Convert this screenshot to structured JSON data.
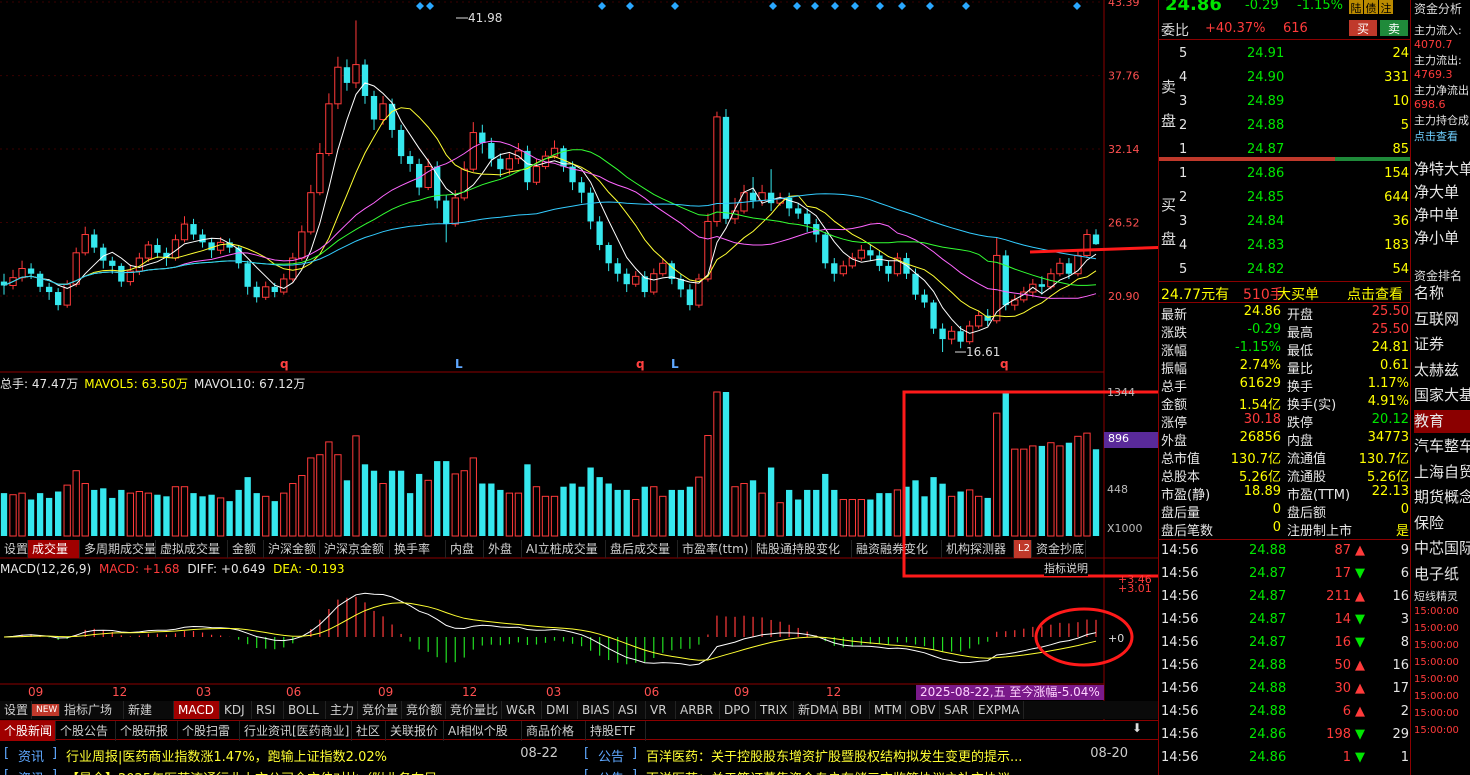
{
  "chart_data": {
    "type": "candlestick",
    "price_axis": {
      "ticks": [
        "43.39",
        "37.76",
        "32.14",
        "26.52",
        "20.90"
      ],
      "range": [
        17.0,
        43.39
      ]
    },
    "annotations": {
      "high": "41.98",
      "low": "16.61"
    },
    "markers": [
      "q",
      "L",
      "q",
      "L",
      "q"
    ],
    "ohlc": [
      [
        22.0,
        21.7,
        21.0,
        22.6
      ],
      [
        21.7,
        22.3,
        21.4,
        22.9
      ],
      [
        22.3,
        23.0,
        22.0,
        23.6
      ],
      [
        23.0,
        22.6,
        22.2,
        23.4
      ],
      [
        22.6,
        21.6,
        21.2,
        22.8
      ],
      [
        21.6,
        21.2,
        20.6,
        21.9
      ],
      [
        21.2,
        20.2,
        19.8,
        21.5
      ],
      [
        20.2,
        21.8,
        20.0,
        22.1
      ],
      [
        21.8,
        24.2,
        21.6,
        24.6
      ],
      [
        24.2,
        25.6,
        24.0,
        26.2
      ],
      [
        25.6,
        24.6,
        24.2,
        26.0
      ],
      [
        24.6,
        23.6,
        23.0,
        24.9
      ],
      [
        23.6,
        23.2,
        22.6,
        23.9
      ],
      [
        23.2,
        22.0,
        21.6,
        23.4
      ],
      [
        22.0,
        22.8,
        21.7,
        23.3
      ],
      [
        22.8,
        23.8,
        22.5,
        24.2
      ],
      [
        23.8,
        24.8,
        23.5,
        25.1
      ],
      [
        24.8,
        24.2,
        23.8,
        25.3
      ],
      [
        24.2,
        23.8,
        23.2,
        24.6
      ],
      [
        23.8,
        25.2,
        23.6,
        25.6
      ],
      [
        25.2,
        26.4,
        25.0,
        27.0
      ],
      [
        26.4,
        25.6,
        25.2,
        26.8
      ],
      [
        25.6,
        25.0,
        24.6,
        26.0
      ],
      [
        25.0,
        24.4,
        23.8,
        25.3
      ],
      [
        24.4,
        25.0,
        24.1,
        25.4
      ],
      [
        25.0,
        24.6,
        24.2,
        25.3
      ],
      [
        24.6,
        23.4,
        23.0,
        24.8
      ],
      [
        23.4,
        21.6,
        21.0,
        23.6
      ],
      [
        21.6,
        20.8,
        20.4,
        22.0
      ],
      [
        20.8,
        21.6,
        20.6,
        22.0
      ],
      [
        21.6,
        21.2,
        20.8,
        21.9
      ],
      [
        21.2,
        22.2,
        21.0,
        22.6
      ],
      [
        22.2,
        23.8,
        22.0,
        24.2
      ],
      [
        23.8,
        25.8,
        23.6,
        26.3
      ],
      [
        25.8,
        28.8,
        25.6,
        29.4
      ],
      [
        28.8,
        31.8,
        28.6,
        32.6
      ],
      [
        31.8,
        35.6,
        31.6,
        36.4
      ],
      [
        35.6,
        38.4,
        35.2,
        39.2
      ],
      [
        38.4,
        37.2,
        36.6,
        39.0
      ],
      [
        37.2,
        38.6,
        36.8,
        41.98
      ],
      [
        38.6,
        36.2,
        35.6,
        39.0
      ],
      [
        36.2,
        34.4,
        33.6,
        36.6
      ],
      [
        34.4,
        35.6,
        34.0,
        36.2
      ],
      [
        35.6,
        33.6,
        33.0,
        36.0
      ],
      [
        33.6,
        31.6,
        31.0,
        34.0
      ],
      [
        31.6,
        31.0,
        30.4,
        32.0
      ],
      [
        31.0,
        29.2,
        28.6,
        31.4
      ],
      [
        29.2,
        30.8,
        29.0,
        31.4
      ],
      [
        30.8,
        28.2,
        27.6,
        31.2
      ],
      [
        28.2,
        26.4,
        25.0,
        28.6
      ],
      [
        26.4,
        28.4,
        26.2,
        29.0
      ],
      [
        28.4,
        30.6,
        28.2,
        31.2
      ],
      [
        30.6,
        33.4,
        30.4,
        34.2
      ],
      [
        33.4,
        32.6,
        31.8,
        34.0
      ],
      [
        32.6,
        31.4,
        30.8,
        33.0
      ],
      [
        31.4,
        30.6,
        30.0,
        31.8
      ],
      [
        30.6,
        31.4,
        30.2,
        31.8
      ],
      [
        31.4,
        32.0,
        31.0,
        32.6
      ],
      [
        32.0,
        29.6,
        29.0,
        32.4
      ],
      [
        29.6,
        30.8,
        29.4,
        31.4
      ],
      [
        30.8,
        31.6,
        30.6,
        32.0
      ],
      [
        31.6,
        32.2,
        31.4,
        32.8
      ],
      [
        32.2,
        30.8,
        30.4,
        32.4
      ],
      [
        30.8,
        29.6,
        29.0,
        31.2
      ],
      [
        29.6,
        28.8,
        28.0,
        30.0
      ],
      [
        28.8,
        26.6,
        26.0,
        29.2
      ],
      [
        26.6,
        24.8,
        24.4,
        27.0
      ],
      [
        24.8,
        23.4,
        22.8,
        25.0
      ],
      [
        23.4,
        22.6,
        22.0,
        23.8
      ],
      [
        22.6,
        21.8,
        21.2,
        23.0
      ],
      [
        21.8,
        22.4,
        21.6,
        22.8
      ],
      [
        22.4,
        21.2,
        20.8,
        22.8
      ],
      [
        21.2,
        22.6,
        21.0,
        23.0
      ],
      [
        22.6,
        23.4,
        22.4,
        23.8
      ],
      [
        23.4,
        22.2,
        21.8,
        23.6
      ],
      [
        22.2,
        21.4,
        20.8,
        22.6
      ],
      [
        21.4,
        20.2,
        19.8,
        21.8
      ],
      [
        20.2,
        22.2,
        20.0,
        22.6
      ],
      [
        22.2,
        26.6,
        22.0,
        27.2
      ],
      [
        26.6,
        34.6,
        26.2,
        35.0
      ],
      [
        34.6,
        26.8,
        26.4,
        35.2
      ],
      [
        26.8,
        27.4,
        26.4,
        28.4
      ],
      [
        27.4,
        28.8,
        27.2,
        29.4
      ],
      [
        28.8,
        28.2,
        27.6,
        30.0
      ],
      [
        28.2,
        28.8,
        27.8,
        29.4
      ],
      [
        28.8,
        28.0,
        27.4,
        30.6
      ],
      [
        28.0,
        28.4,
        27.8,
        28.8
      ],
      [
        28.4,
        27.6,
        27.0,
        28.8
      ],
      [
        27.6,
        27.2,
        26.8,
        28.0
      ],
      [
        27.2,
        26.4,
        25.8,
        27.6
      ],
      [
        26.4,
        25.6,
        25.0,
        26.8
      ],
      [
        25.6,
        23.4,
        23.0,
        25.8
      ],
      [
        23.4,
        22.6,
        22.0,
        23.8
      ],
      [
        22.6,
        23.2,
        22.4,
        23.6
      ],
      [
        23.2,
        23.8,
        23.0,
        24.2
      ],
      [
        23.8,
        24.4,
        23.6,
        24.8
      ],
      [
        24.4,
        24.0,
        23.6,
        24.8
      ],
      [
        24.0,
        23.2,
        22.8,
        24.4
      ],
      [
        23.2,
        22.6,
        22.0,
        23.6
      ],
      [
        22.6,
        23.8,
        22.4,
        24.2
      ],
      [
        23.8,
        22.6,
        22.2,
        24.2
      ],
      [
        22.6,
        21.0,
        20.6,
        23.0
      ],
      [
        21.0,
        20.4,
        20.0,
        21.4
      ],
      [
        20.4,
        18.4,
        18.0,
        20.6
      ],
      [
        18.4,
        17.6,
        16.61,
        18.8
      ],
      [
        17.6,
        18.2,
        17.2,
        18.6
      ],
      [
        18.2,
        17.4,
        16.9,
        18.6
      ],
      [
        17.4,
        18.6,
        17.2,
        19.0
      ],
      [
        18.6,
        19.4,
        18.4,
        19.8
      ],
      [
        19.4,
        19.0,
        18.6,
        19.9
      ],
      [
        19.0,
        24.0,
        18.8,
        25.4
      ],
      [
        24.0,
        20.2,
        19.8,
        24.4
      ],
      [
        20.2,
        20.6,
        19.8,
        21.0
      ],
      [
        20.6,
        21.2,
        20.4,
        21.6
      ],
      [
        21.2,
        21.8,
        20.8,
        22.2
      ],
      [
        21.8,
        21.6,
        21.0,
        22.4
      ],
      [
        21.6,
        22.6,
        21.4,
        23.0
      ],
      [
        22.6,
        23.4,
        22.4,
        23.8
      ],
      [
        23.4,
        22.6,
        22.2,
        23.8
      ],
      [
        22.6,
        24.0,
        22.4,
        24.4
      ],
      [
        24.0,
        25.6,
        23.8,
        26.0
      ],
      [
        25.6,
        24.86,
        24.81,
        26.0
      ]
    ]
  },
  "price_panel": {
    "vol_legend": {
      "prefix": "总手: ",
      "total": "47.47万",
      "ma5_label": "MAVOL5: ",
      "ma5": "63.50万",
      "ma10_label": "MAVOL10: ",
      "ma10": "67.12万"
    },
    "vol_axis": [
      "1344",
      "896",
      "448",
      "X1000"
    ],
    "macd_legend": {
      "name": "MACD(12,26,9)",
      "macd": "MACD: +1.68",
      "diff": "DIFF: +0.649",
      "dea": "DEA: -0.193"
    },
    "macd_axis": [
      "+3.46",
      "+3.01",
      "+0"
    ],
    "x_axis": [
      "09",
      "12",
      "03",
      "06",
      "09",
      "12",
      "03",
      "06",
      "09",
      "12"
    ],
    "date_tag": "2025-08-22,五 至今涨幅-5.04%",
    "tip": "指标说明"
  },
  "vol_tabs": [
    "设置",
    "成交量",
    "多周期成交量",
    "虚拟成交量",
    "金额",
    "沪深金额",
    "沪深京金额",
    "换手率",
    "内盘",
    "外盘",
    "AI立桩成交量",
    "盘后成交量",
    "市盈率(ttm)",
    "陆股通持股变化",
    "融资融券变化",
    "机构探测器",
    "L2",
    "资金抄底"
  ],
  "ind_tabs": [
    "设置",
    "NEW",
    "指标广场",
    "新建",
    "MACD",
    "KDJ",
    "RSI",
    "BOLL",
    "主力",
    "竞价量",
    "竞价额",
    "竞价量比",
    "W&R",
    "DMI",
    "BIAS",
    "ASI",
    "VR",
    "ARBR",
    "DPO",
    "TRIX",
    "新DMA",
    "BBI",
    "MTM",
    "OBV",
    "SAR",
    "EXPMA"
  ],
  "news_tabs": [
    "个股新闻",
    "个股公告",
    "个股研报",
    "个股扫雷",
    "行业资讯[医药商业]",
    "社区",
    "关联报价",
    "AI相似个股",
    "商品价格",
    "持股ETF"
  ],
  "news": [
    {
      "tag": "资讯",
      "text": "行业周报|医药商业指数涨1.47%，跑输上证指数2.02%",
      "date": "08-22"
    },
    {
      "tag": "公告",
      "text": "百洋医药：关于控股股东增资扩股暨股权结构拟发生变更的提示...",
      "date": "08-20"
    },
    {
      "tag": "资讯",
      "text": "【最全】2025年医药流通行业上市公司全方位对比（附业务布局...",
      "date": ""
    },
    {
      "tag": "公告",
      "text": "百洋医药：关于签订募集资金专户存储三方监管协议之补充协议...",
      "date": ""
    }
  ],
  "quote": {
    "price": "24.86",
    "change": "-0.29",
    "pct": "-1.15%",
    "badges": [
      "陆",
      "债",
      "注"
    ],
    "wb_label": "委比",
    "wb_value": "+40.37%",
    "wb_diff": "616",
    "buy_btn": "买",
    "sell_btn": "卖",
    "sell_label": "卖盘",
    "buy_label": "买盘",
    "asks": [
      [
        "5",
        "24.91",
        "24"
      ],
      [
        "4",
        "24.90",
        "331"
      ],
      [
        "3",
        "24.89",
        "10"
      ],
      [
        "2",
        "24.88",
        "5"
      ],
      [
        "1",
        "24.87",
        "85"
      ]
    ],
    "bids": [
      [
        "1",
        "24.86",
        "154"
      ],
      [
        "2",
        "24.85",
        "644"
      ],
      [
        "3",
        "24.84",
        "36"
      ],
      [
        "4",
        "24.83",
        "183"
      ],
      [
        "5",
        "24.82",
        "54"
      ]
    ],
    "big_order": {
      "price": "24.77元有",
      "vol": "510手",
      "label": "大买单",
      "link": "点击查看"
    },
    "stats": [
      [
        "最新",
        "24.86",
        "开盘",
        "25.50"
      ],
      [
        "涨跌",
        "-0.29",
        "最高",
        "25.50"
      ],
      [
        "涨幅",
        "-1.15%",
        "最低",
        "24.81"
      ],
      [
        "振幅",
        "2.74%",
        "量比",
        "0.61"
      ],
      [
        "总手",
        "61629",
        "换手",
        "1.17%"
      ],
      [
        "金额",
        "1.54亿",
        "换手(实)",
        "4.91%"
      ],
      [
        "涨停",
        "30.18",
        "跌停",
        "20.12"
      ],
      [
        "外盘",
        "26856",
        "内盘",
        "34773"
      ],
      [
        "总市值",
        "130.7亿",
        "流通值",
        "130.7亿"
      ],
      [
        "总股本",
        "5.26亿",
        "流通股",
        "5.26亿"
      ],
      [
        "市盈(静)",
        "18.89",
        "市盈(TTM)",
        "22.13"
      ],
      [
        "盘后量",
        "0",
        "盘后额",
        "0"
      ],
      [
        "盘后笔数",
        "0",
        "注册制上市",
        "是"
      ]
    ],
    "ticks": [
      [
        "14:56",
        "24.88",
        "87",
        "9"
      ],
      [
        "14:56",
        "24.87",
        "17",
        "6"
      ],
      [
        "14:56",
        "24.87",
        "211",
        "16"
      ],
      [
        "14:56",
        "24.87",
        "14",
        "3"
      ],
      [
        "14:56",
        "24.87",
        "16",
        "8"
      ],
      [
        "14:56",
        "24.88",
        "50",
        "16"
      ],
      [
        "14:56",
        "24.88",
        "30",
        "17"
      ],
      [
        "14:56",
        "24.88",
        "6",
        "2"
      ],
      [
        "14:56",
        "24.86",
        "198",
        "29"
      ],
      [
        "14:56",
        "24.86",
        "1",
        "1"
      ]
    ]
  },
  "side": {
    "title": "资金分析",
    "flows": [
      [
        "主力流入:",
        "4070.7"
      ],
      [
        "主力流出:",
        "4769.3"
      ],
      [
        "主力净流出",
        "698.6"
      ],
      [
        "主力持仓成",
        "点击查看"
      ]
    ],
    "sizes": [
      "净特大单",
      "净大单",
      "净中单",
      "净小单"
    ],
    "rank_title": "资金排名",
    "rank": [
      "名称",
      "互联网",
      "证券",
      "太赫兹",
      "国家大基",
      "教育",
      "汽车整车",
      "上海自贸",
      "期货概念",
      "保险",
      "中芯国际",
      "电子纸"
    ],
    "news_title": "短线精灵",
    "news_times": [
      "15:00:00",
      "15:00:00",
      "15:00:00",
      "15:00:00",
      "15:00:00",
      "15:00:00",
      "15:00:00",
      "15:00:00"
    ]
  }
}
